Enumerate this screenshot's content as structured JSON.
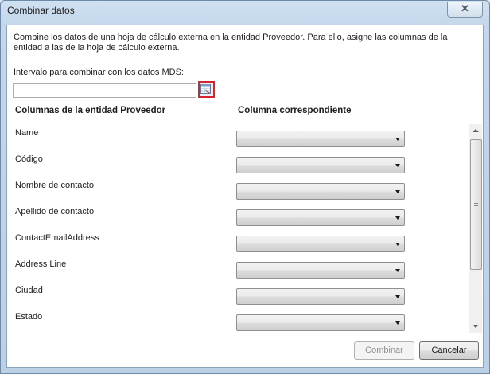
{
  "window": {
    "title": "Combinar datos",
    "close_glyph": "✕"
  },
  "description": "Combine los datos de una hoja de cálculo externa en la entidad Proveedor. Para ello, asigne las columnas de la entidad a las de la hoja de cálculo externa.",
  "range": {
    "label": "Intervalo para combinar con los datos MDS:",
    "value": "",
    "picker_icon": "range-picker-icon"
  },
  "columns": {
    "left_header": "Columnas de la entidad Proveedor",
    "right_header": "Columna correspondiente"
  },
  "rows": [
    {
      "label": "Name",
      "selected": ""
    },
    {
      "label": "Código",
      "selected": ""
    },
    {
      "label": "Nombre de contacto",
      "selected": ""
    },
    {
      "label": "Apellido de contacto",
      "selected": ""
    },
    {
      "label": "ContactEmailAddress",
      "selected": ""
    },
    {
      "label": "Address Line",
      "selected": ""
    },
    {
      "label": "Ciudad",
      "selected": ""
    },
    {
      "label": "Estado",
      "selected": ""
    }
  ],
  "buttons": {
    "combine": "Combinar",
    "cancel": "Cancelar"
  },
  "colors": {
    "picker_highlight": "#d8232a",
    "title_bar": "#c4d7ec"
  }
}
